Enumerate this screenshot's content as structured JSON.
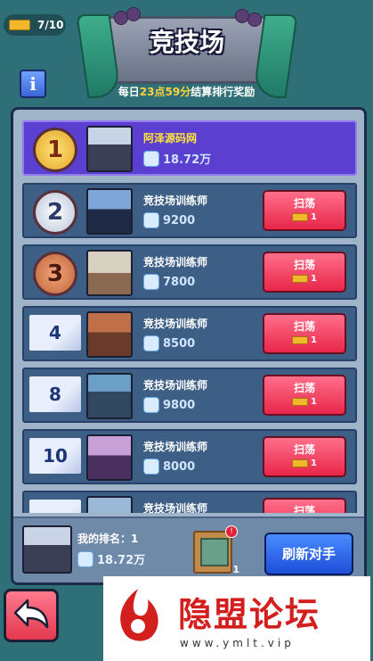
{
  "top": {
    "ticket_count": "7/10",
    "info_label": "i"
  },
  "banner": {
    "title": "竞技场",
    "subtitle_prefix": "每日",
    "subtitle_time": "23点59分",
    "subtitle_suffix": "结算排行奖励"
  },
  "list": {
    "rows": [
      {
        "rank": "1",
        "name": "阿泽源码网",
        "power": "18.72万",
        "is_self": true
      },
      {
        "rank": "2",
        "name": "竞技场训练师",
        "power": "9200",
        "sweep_label": "扫荡",
        "sweep_cost": "1"
      },
      {
        "rank": "3",
        "name": "竞技场训练师",
        "power": "7800",
        "sweep_label": "扫荡",
        "sweep_cost": "1"
      },
      {
        "rank": "4",
        "name": "竞技场训练师",
        "power": "8500",
        "sweep_label": "扫荡",
        "sweep_cost": "1"
      },
      {
        "rank": "8",
        "name": "竞技场训练师",
        "power": "9800",
        "sweep_label": "扫荡",
        "sweep_cost": "1"
      },
      {
        "rank": "10",
        "name": "竞技场训练师",
        "power": "8000",
        "sweep_label": "扫荡",
        "sweep_cost": "1"
      },
      {
        "rank": "",
        "name": "竞技场训练师",
        "power": "",
        "sweep_label": "扫荡",
        "sweep_cost": ""
      }
    ]
  },
  "footer": {
    "my_rank_label": "我的排名：1",
    "my_power": "18.72万",
    "reward_qty": "1",
    "alert": "!",
    "refresh_label": "刷新对手"
  },
  "watermark": {
    "title": "隐盟论坛",
    "url": "www.ymlt.vip"
  },
  "colors": {
    "accent": "#e8264a",
    "self_row": "#5a3fd0",
    "refresh": "#1e4ed8"
  }
}
